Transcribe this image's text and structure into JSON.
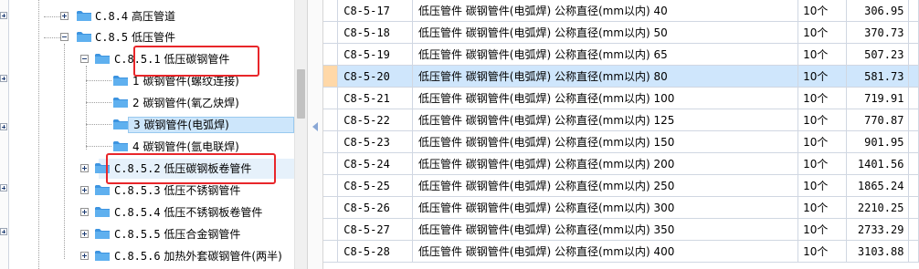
{
  "tree": {
    "items": [
      {
        "code": "C.8.4",
        "label": "高压管道"
      },
      {
        "code": "C.8.5",
        "label": "低压管件"
      },
      {
        "code": "C.8.5.1",
        "label": "低压碳钢管件"
      },
      {
        "code": "1",
        "label": "碳钢管件(螺纹连接)"
      },
      {
        "code": "2",
        "label": "碳钢管件(氧乙炔焊)"
      },
      {
        "code": "3",
        "label": "碳钢管件(电弧焊)"
      },
      {
        "code": "4",
        "label": "碳钢管件(氩电联焊)"
      },
      {
        "code": "C.8.5.2",
        "label": "低压碳钢板卷管件"
      },
      {
        "code": "C.8.5.3",
        "label": "低压不锈钢管件"
      },
      {
        "code": "C.8.5.4",
        "label": "低压不锈钢板卷管件"
      },
      {
        "code": "C.8.5.5",
        "label": "低压合金钢管件"
      },
      {
        "code": "C.8.5.6",
        "label": "加热外套碳钢管件(两半)"
      }
    ]
  },
  "grid": {
    "rows": [
      {
        "code": "C8-5-17",
        "name": "低压管件 碳钢管件(电弧焊) 公称直径(mm以内) 40",
        "unit": "10个",
        "price": "306.95"
      },
      {
        "code": "C8-5-18",
        "name": "低压管件 碳钢管件(电弧焊) 公称直径(mm以内) 50",
        "unit": "10个",
        "price": "370.73"
      },
      {
        "code": "C8-5-19",
        "name": "低压管件 碳钢管件(电弧焊) 公称直径(mm以内) 65",
        "unit": "10个",
        "price": "507.23"
      },
      {
        "code": "C8-5-20",
        "name": "低压管件 碳钢管件(电弧焊) 公称直径(mm以内) 80",
        "unit": "10个",
        "price": "581.73"
      },
      {
        "code": "C8-5-21",
        "name": "低压管件 碳钢管件(电弧焊) 公称直径(mm以内) 100",
        "unit": "10个",
        "price": "719.91"
      },
      {
        "code": "C8-5-22",
        "name": "低压管件 碳钢管件(电弧焊) 公称直径(mm以内) 125",
        "unit": "10个",
        "price": "770.87"
      },
      {
        "code": "C8-5-23",
        "name": "低压管件 碳钢管件(电弧焊) 公称直径(mm以内) 150",
        "unit": "10个",
        "price": "901.95"
      },
      {
        "code": "C8-5-24",
        "name": "低压管件 碳钢管件(电弧焊) 公称直径(mm以内) 200",
        "unit": "10个",
        "price": "1401.56"
      },
      {
        "code": "C8-5-25",
        "name": "低压管件 碳钢管件(电弧焊) 公称直径(mm以内) 250",
        "unit": "10个",
        "price": "1865.24"
      },
      {
        "code": "C8-5-26",
        "name": "低压管件 碳钢管件(电弧焊) 公称直径(mm以内) 300",
        "unit": "10个",
        "price": "2210.25"
      },
      {
        "code": "C8-5-27",
        "name": "低压管件 碳钢管件(电弧焊) 公称直径(mm以内) 350",
        "unit": "10个",
        "price": "2733.29"
      },
      {
        "code": "C8-5-28",
        "name": "低压管件 碳钢管件(电弧焊) 公称直径(mm以内) 400",
        "unit": "10个",
        "price": "3103.88"
      }
    ]
  },
  "colors": {
    "folder": "#3d94e0",
    "selection": "#cde6fb",
    "row_indicator": "#ffd8a8",
    "annotation_red": "#e8262a"
  },
  "icons": {
    "expander_collapsed": "plus-box",
    "expander_expanded": "minus-box",
    "folder": "folder-icon",
    "splitter": "triangle-left"
  }
}
